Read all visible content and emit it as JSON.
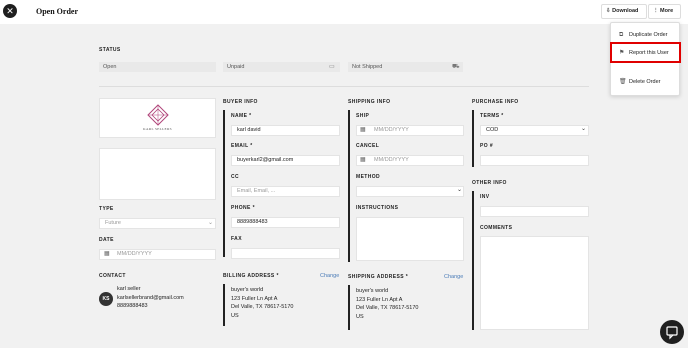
{
  "header": {
    "title": "Open Order",
    "download_label": "Download",
    "more_label": "More"
  },
  "status": {
    "label": "STATUS",
    "fields": [
      "Open",
      "Unpaid",
      "Not Shipped"
    ]
  },
  "left": {
    "logo_text": "KARL SELLERS",
    "type_label": "TYPE",
    "type_value": "Future",
    "date_label": "DATE",
    "date_placeholder": "MM/DD/YYYY",
    "contact_label": "CONTACT",
    "contact_initials": "KS",
    "contact_name": "karl seller",
    "contact_email": "karlsellerbrand@gmail.com",
    "contact_phone": "8889888483"
  },
  "buyer": {
    "heading": "BUYER INFO",
    "name_label": "NAME *",
    "name_value": "karl david",
    "email_label": "EMAIL *",
    "email_value": "buyerkarl2@gmail.com",
    "cc_label": "CC",
    "cc_placeholder": "Email, Email, ...",
    "phone_label": "PHONE *",
    "phone_value": "8889888483",
    "fax_label": "FAX",
    "billing_label": "BILLING ADDRESS *",
    "billing_change": "Change",
    "billing_lines": [
      "buyer's world",
      "123 Fuller Ln Apt A",
      "Del Valle, TX 78617-5170",
      "US"
    ]
  },
  "shipping": {
    "heading": "SHIPPING INFO",
    "ship_label": "SHIP",
    "ship_placeholder": "MM/DD/YYYY",
    "cancel_label": "CANCEL",
    "cancel_placeholder": "MM/DD/YYYY",
    "method_label": "METHOD",
    "instructions_label": "INSTRUCTIONS",
    "address_label": "SHIPPING ADDRESS *",
    "address_change": "Change",
    "address_lines": [
      "buyer's world",
      "123 Fuller Ln Apt A",
      "Del Valle, TX 78617-5170",
      "US"
    ]
  },
  "purchase": {
    "heading": "PURCHASE INFO",
    "terms_label": "TERMS *",
    "terms_value": "COD",
    "po_label": "PO #",
    "other_heading": "OTHER INFO",
    "inv_label": "INV",
    "comments_label": "COMMENTS"
  },
  "menu": {
    "items": [
      "Duplicate Order",
      "Report this User",
      "Delete Order"
    ]
  },
  "colors": {
    "highlight": "#e00000",
    "link": "#4a7bb7"
  }
}
